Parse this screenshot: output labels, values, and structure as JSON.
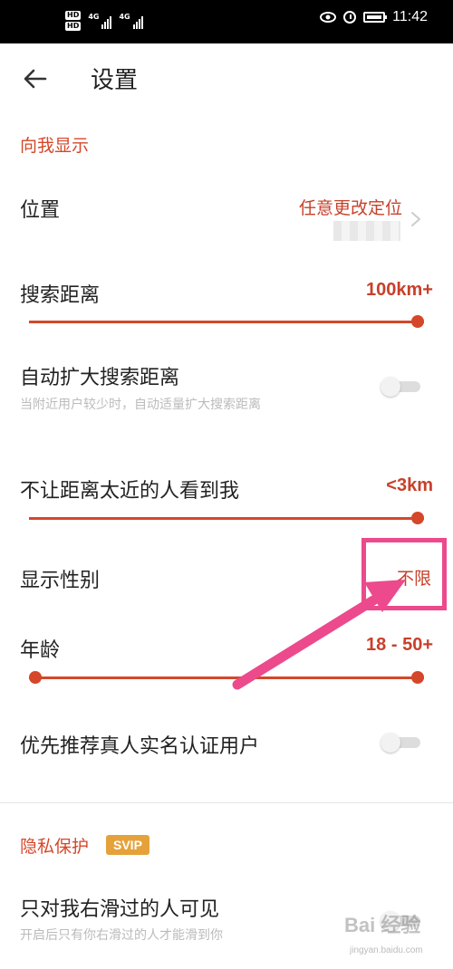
{
  "status_bar": {
    "hd_labels": [
      "HD",
      "HD"
    ],
    "network_labels": [
      "4G",
      "4G"
    ],
    "time": "11:42"
  },
  "header": {
    "title": "设置"
  },
  "sections": {
    "show_to_me": {
      "title": "向我显示",
      "location_label": "位置",
      "location_value": "任意更改定位",
      "search_distance_label": "搜索距离",
      "search_distance_value": "100km+",
      "search_distance_fraction": 1.0,
      "auto_expand_label": "自动扩大搜索距离",
      "auto_expand_sub": "当附近用户较少时，自动适量扩大搜索距离",
      "auto_expand_on": false,
      "hide_near_label": "不让距离太近的人看到我",
      "hide_near_value": "<3km",
      "hide_near_fraction": 1.0,
      "gender_label": "显示性别",
      "gender_value": "不限",
      "age_label": "年龄",
      "age_value": "18 - 50+",
      "age_range_fraction": [
        0.0,
        1.0
      ],
      "verified_label": "优先推荐真人实名认证用户",
      "verified_on": false
    },
    "privacy": {
      "title": "隐私保护",
      "badge": "SVIP",
      "swiped_only_label": "只对我右滑过的人可见",
      "swiped_only_sub": "开启后只有你右滑过的人才能滑到你",
      "swiped_only_on": false
    }
  },
  "watermark": {
    "text": "Bai 经验",
    "sub": "jingyan.baidu.com"
  },
  "colors": {
    "accent": "#d4472a",
    "annotation": "#ec4a8c",
    "badge": "#e5a23a"
  }
}
